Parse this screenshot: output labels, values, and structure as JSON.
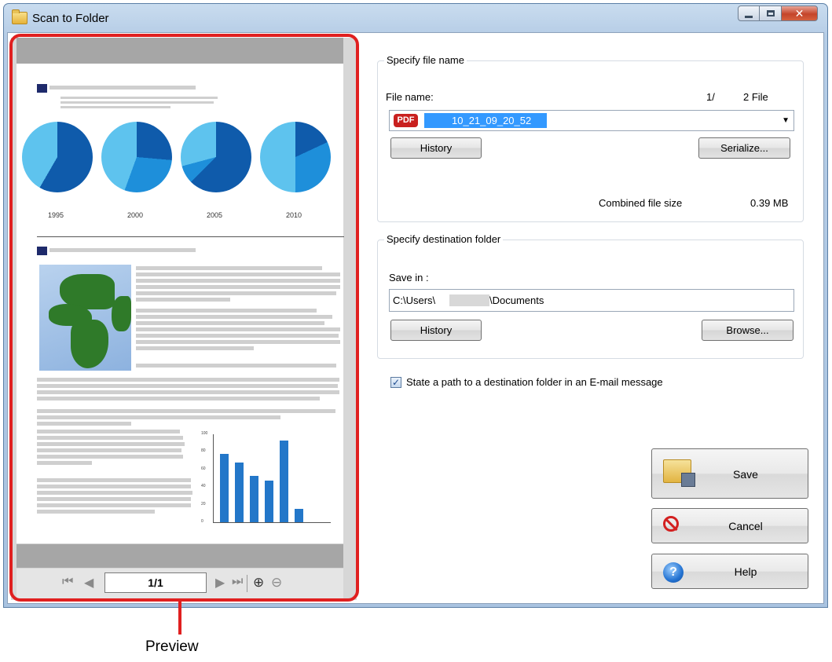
{
  "window": {
    "title": "Scan to Folder"
  },
  "preview": {
    "page_indicator": "1/1",
    "callout_label": "Preview",
    "pie_years": [
      "1995",
      "2000",
      "2005",
      "2010"
    ],
    "bar_values": [
      78,
      68,
      53,
      47,
      93,
      15
    ],
    "bar_axis_ticks": [
      "100",
      "80",
      "60",
      "40",
      "20",
      "0"
    ]
  },
  "file_name_group": {
    "legend": "Specify file name",
    "file_name_label": "File name:",
    "file_count": "1/",
    "file_total": "2 File",
    "file_type_badge": "PDF",
    "file_name_value": "10_21_09_20_52",
    "history_button": "History",
    "serialize_button": "Serialize...",
    "combined_size_label": "Combined file size",
    "combined_size_value": "0.39 MB"
  },
  "destination_group": {
    "legend": "Specify destination folder",
    "save_in_label": "Save in :",
    "path_prefix": "C:\\Users\\",
    "path_suffix": "\\Documents",
    "history_button": "History",
    "browse_button": "Browse..."
  },
  "email_option": {
    "label": "State a path to a destination folder in an E-mail message",
    "checked": true
  },
  "actions": {
    "save": "Save",
    "cancel": "Cancel",
    "help": "Help"
  },
  "colors": {
    "accent_red": "#e02020",
    "selection": "#3399ff",
    "chart_blue": "#2377c9"
  }
}
